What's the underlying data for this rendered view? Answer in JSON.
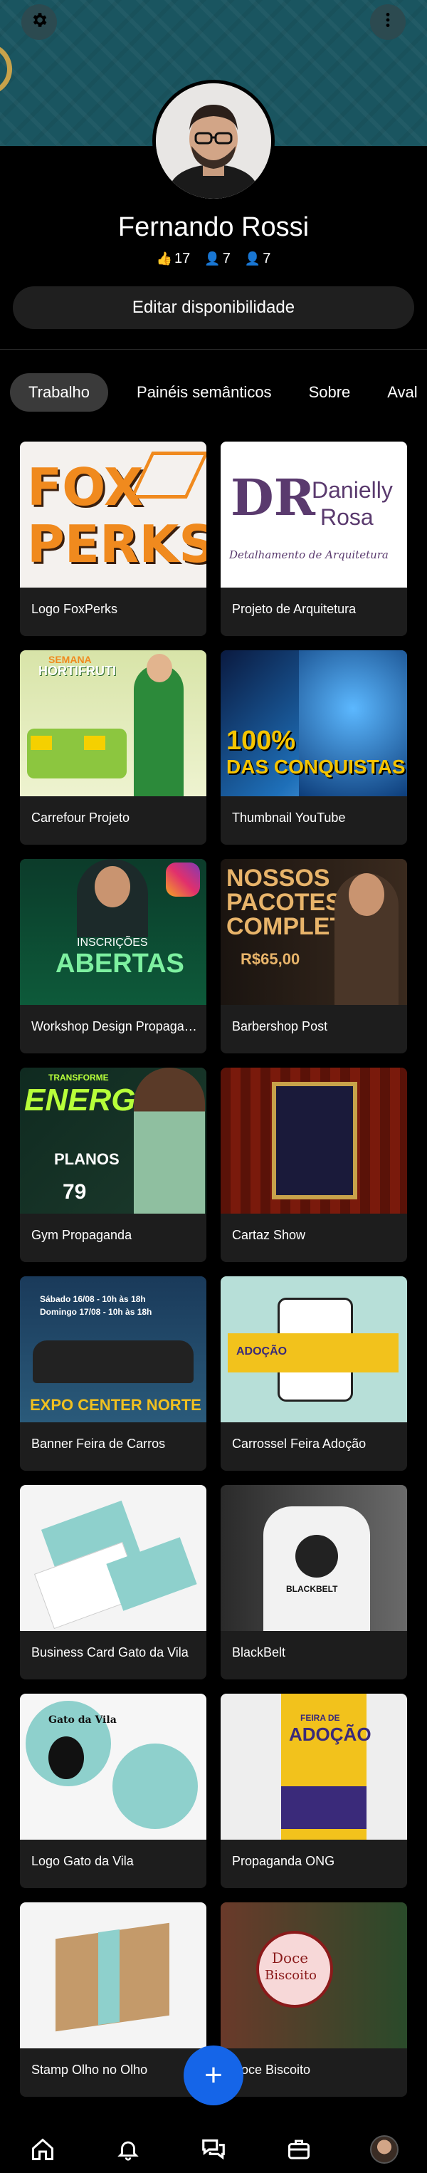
{
  "profile": {
    "name": "Fernando Rossi",
    "stats": {
      "likes": "17",
      "followers": "7",
      "following": "7"
    },
    "edit_button": "Editar disponibilidade"
  },
  "header": {
    "settings_icon": "gear-icon",
    "menu_icon": "more-vertical-icon"
  },
  "tabs": [
    {
      "label": "Trabalho",
      "active": true
    },
    {
      "label": "Painéis semânticos"
    },
    {
      "label": "Sobre"
    },
    {
      "label": "Aval"
    }
  ],
  "projects": [
    {
      "title": "Logo FoxPerks",
      "art": {
        "l1": "FOX",
        "l2": "PERKS"
      }
    },
    {
      "title": "Projeto de Arquitetura",
      "art": {
        "l1": "Danielly",
        "l2": "Rosa",
        "l3": "Detalhamento de Arquitetura",
        "mono": "DR"
      }
    },
    {
      "title": "Carrefour Projeto",
      "art": {
        "l1": "SEMANA",
        "l2": "HORTIFRUTI"
      }
    },
    {
      "title": "Thumbnail YouTube",
      "art": {
        "l1": "100%",
        "l2": "DAS CONQUISTAS"
      }
    },
    {
      "title": "Workshop Design Propaganda",
      "art": {
        "l1": "INSCRIÇÕES",
        "l2": "ABERTAS"
      }
    },
    {
      "title": "Barbershop Post",
      "art": {
        "l1": "NOSSOS",
        "l2": "PACOTES",
        "l3": "COMPLETOS",
        "l4": "R$65,00"
      }
    },
    {
      "title": "Gym Propaganda",
      "art": {
        "l1": "TRANSFORME",
        "l2": "ENERGIA",
        "l3": "PLANOS",
        "l4": "79"
      }
    },
    {
      "title": "Cartaz Show",
      "art": {}
    },
    {
      "title": "Banner Feira de Carros",
      "art": {
        "l1": "Sábado 16/08 - 10h às 18h",
        "l2": "Domingo 17/08 - 10h às 18h",
        "l3": "EXPO CENTER NORTE"
      }
    },
    {
      "title": "Carrossel Feira Adoção",
      "art": {
        "l1": "ADOÇÃO"
      }
    },
    {
      "title": "Business Card Gato da Vila",
      "art": {}
    },
    {
      "title": "BlackBelt",
      "art": {
        "l1": "BLACKBELT"
      }
    },
    {
      "title": "Logo Gato da Vila",
      "art": {
        "l1": "Gato da Vila"
      }
    },
    {
      "title": "Propaganda ONG",
      "art": {
        "l1": "FEIRA DE",
        "l2": "ADOÇÃO"
      }
    },
    {
      "title": "Stamp Olho no Olho",
      "art": {}
    },
    {
      "title": "Doce Biscoito",
      "art": {
        "l1": "Doce",
        "l2": "Biscoito"
      }
    }
  ],
  "fab": {
    "label": "+"
  },
  "nav": [
    "home-icon",
    "bell-icon",
    "chat-icon",
    "briefcase-icon",
    "profile-avatar"
  ],
  "colors": {
    "banner": "#1a5560",
    "fab": "#1565e8",
    "card": "#1d1d1d",
    "active_tab": "#3a3a3a"
  }
}
